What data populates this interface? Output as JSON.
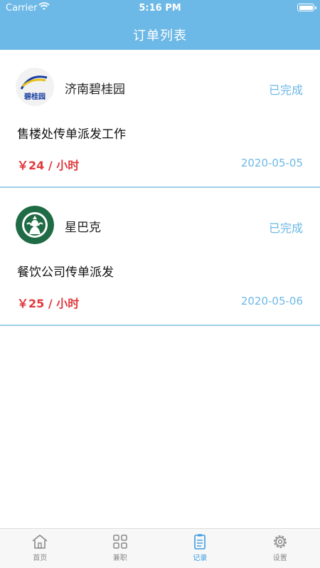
{
  "status_bar": {
    "carrier": "Carrier",
    "time": "5:16 PM"
  },
  "header": {
    "title": "订单列表"
  },
  "orders": [
    {
      "company": "济南碧桂园",
      "logo_text": "碧桂园",
      "status": "已完成",
      "job": "售楼处传单派发工作",
      "pay": "￥24 / 小时",
      "date": "2020-05-05",
      "logo_icon": "country-garden-logo"
    },
    {
      "company": "星巴克",
      "status": "已完成",
      "job": "餐饮公司传单派发",
      "pay": "￥25 / 小时",
      "date": "2020-05-06",
      "logo_icon": "starbucks-logo"
    }
  ],
  "tabs": [
    {
      "label": "首页",
      "icon": "home-icon"
    },
    {
      "label": "兼职",
      "icon": "grid-icon"
    },
    {
      "label": "记录",
      "icon": "record-icon",
      "active": true
    },
    {
      "label": "设置",
      "icon": "gear-icon"
    }
  ],
  "colors": {
    "header": "#6cb8e6",
    "accent": "#6cb8e6",
    "price": "#e0393e"
  }
}
